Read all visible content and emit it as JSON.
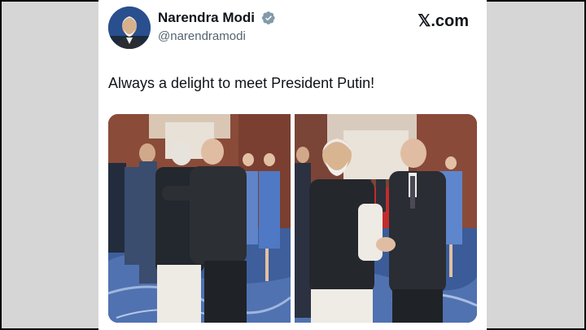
{
  "author": {
    "name": "Narendra Modi",
    "handle": "@narendramodi",
    "verified_icon": "verified-badge-icon",
    "avatar_icon": "avatar-icon"
  },
  "brand": {
    "site": "𝕏.com"
  },
  "tweet": {
    "text": "Always a delight to meet President Putin!"
  },
  "media": [
    {
      "name": "photo-1",
      "description_icon": "photo-icon"
    },
    {
      "name": "photo-2",
      "description_icon": "photo-icon"
    }
  ],
  "colors": {
    "text": "#0f1419",
    "secondary": "#536471",
    "verified": "#829aab",
    "background": "#d6d6d6"
  }
}
